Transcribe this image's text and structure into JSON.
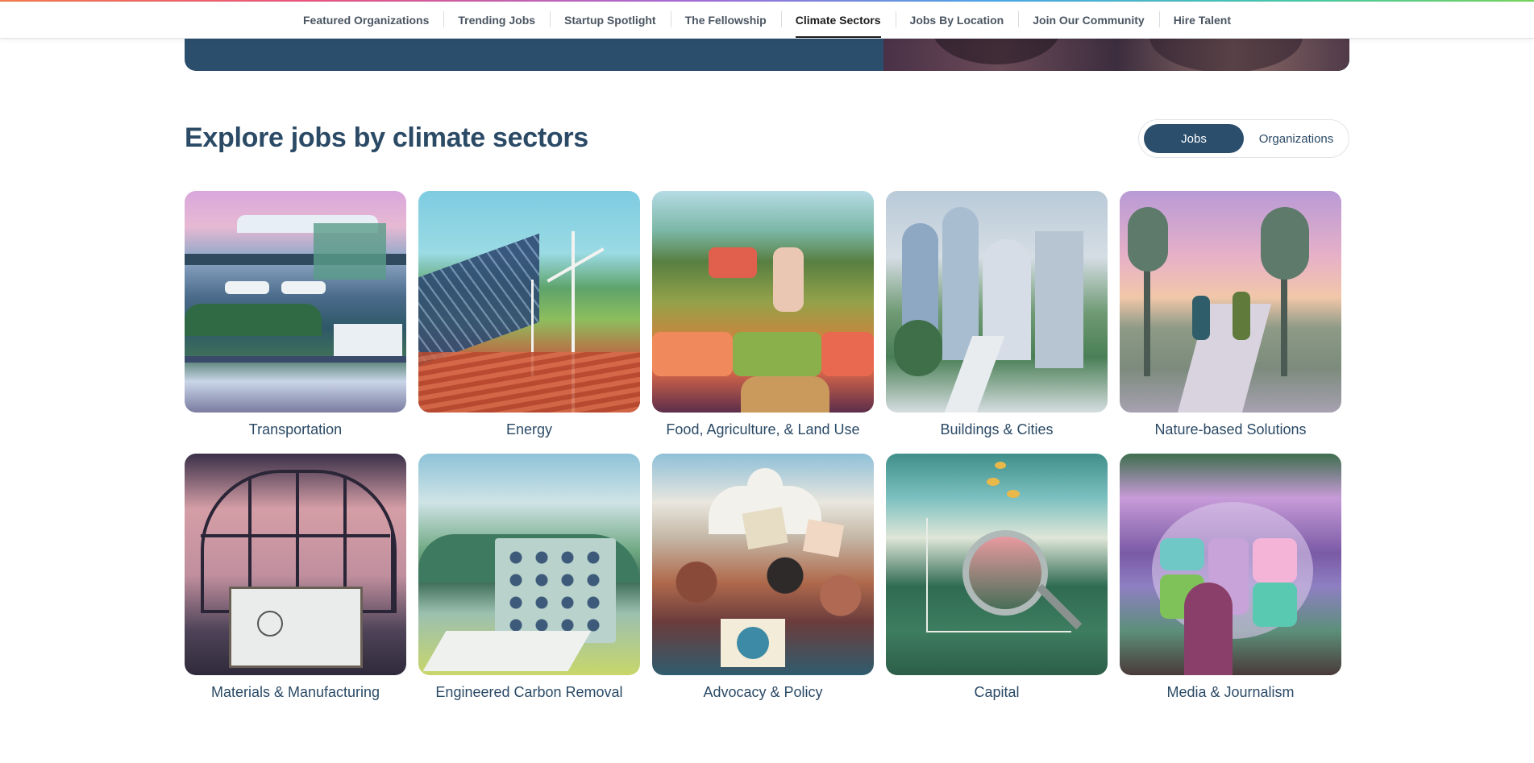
{
  "nav": {
    "items": [
      {
        "label": "Featured Organizations"
      },
      {
        "label": "Trending Jobs"
      },
      {
        "label": "Startup Spotlight"
      },
      {
        "label": "The Fellowship"
      },
      {
        "label": "Climate Sectors"
      },
      {
        "label": "Jobs By Location"
      },
      {
        "label": "Join Our Community"
      },
      {
        "label": "Hire Talent"
      }
    ],
    "active": "Climate Sectors"
  },
  "section": {
    "title": "Explore jobs by climate sectors"
  },
  "toggle": {
    "jobs_label": "Jobs",
    "organizations_label": "Organizations",
    "selected": "Jobs"
  },
  "sectors": [
    {
      "label": "Transportation"
    },
    {
      "label": "Energy"
    },
    {
      "label": "Food, Agriculture, & Land Use"
    },
    {
      "label": "Buildings & Cities"
    },
    {
      "label": "Nature-based Solutions"
    },
    {
      "label": "Materials & Manufacturing"
    },
    {
      "label": "Engineered Carbon Removal"
    },
    {
      "label": "Advocacy & Policy"
    },
    {
      "label": "Capital"
    },
    {
      "label": "Media & Journalism"
    }
  ],
  "colors": {
    "brand_navy": "#2b4e6d",
    "heading_text": "#2b4a66",
    "nav_text": "#4a5561",
    "active_nav_text": "#1c1c1c"
  }
}
